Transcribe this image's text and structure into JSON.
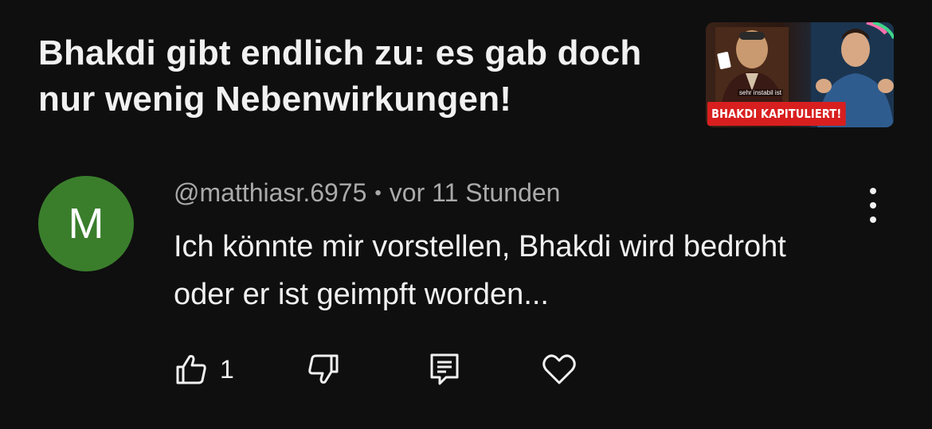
{
  "video": {
    "title": "Bhakdi gibt endlich zu: es gab doch nur wenig Nebenwirkungen!",
    "thumbnail": {
      "banner_text": "BHAKDI KAPITULIERT!",
      "caption_text": "sehr instabil ist"
    }
  },
  "comment": {
    "avatar_letter": "M",
    "avatar_color": "#3a7e2c",
    "author": "@matthiasr.6975",
    "separator": "•",
    "time": "vor 11 Stunden",
    "text": "Ich könnte mir vorstellen, Bhakdi wird bedroht oder er ist geimpft worden...",
    "like_count": "1"
  },
  "icons": {
    "like": "thumbs-up-icon",
    "dislike": "thumbs-down-icon",
    "reply": "reply-comment-icon",
    "heart": "heart-icon",
    "menu": "more-vertical-icon"
  }
}
